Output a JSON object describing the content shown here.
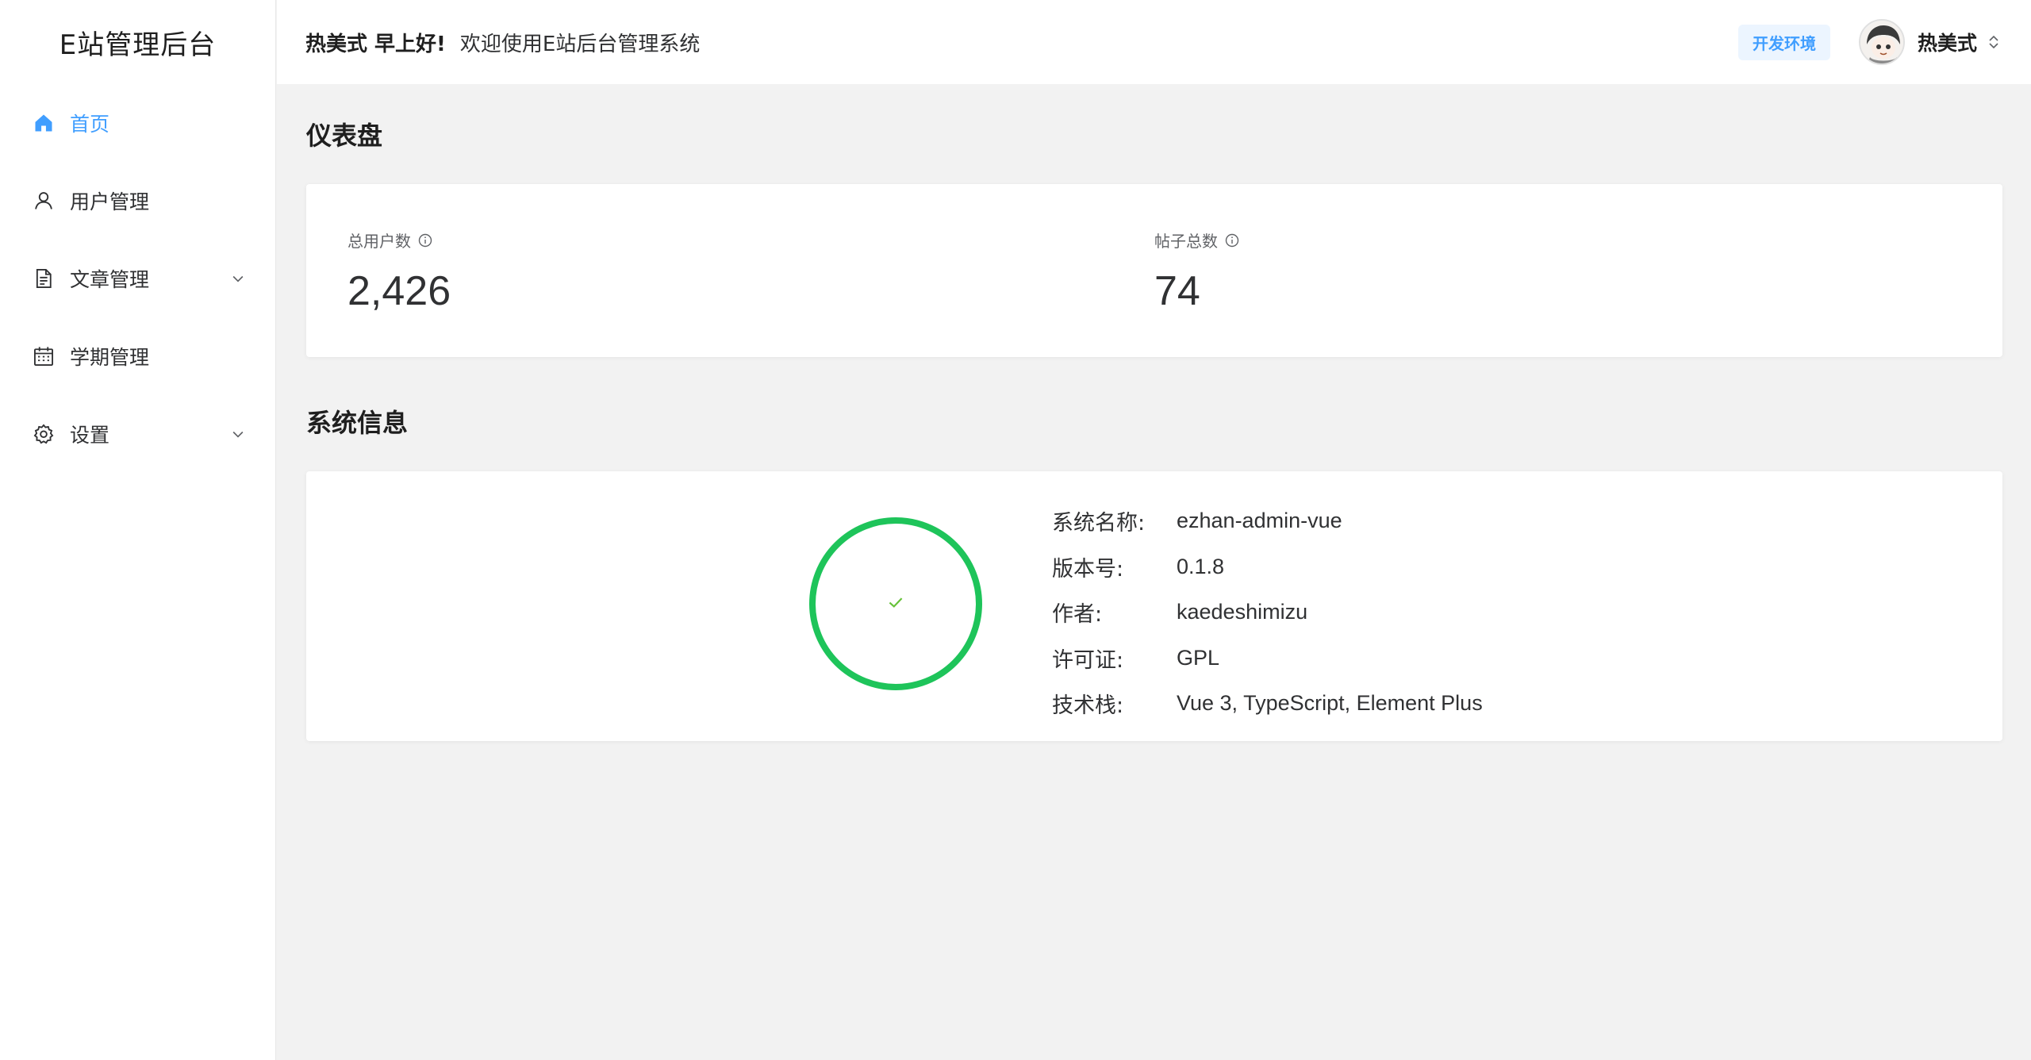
{
  "app": {
    "title": "E站管理后台"
  },
  "sidebar": {
    "items": [
      {
        "label": "首页",
        "icon": "home-icon",
        "active": true,
        "expandable": false
      },
      {
        "label": "用户管理",
        "icon": "user-icon",
        "active": false,
        "expandable": false
      },
      {
        "label": "文章管理",
        "icon": "document-icon",
        "active": false,
        "expandable": true
      },
      {
        "label": "学期管理",
        "icon": "calendar-icon",
        "active": false,
        "expandable": false
      },
      {
        "label": "设置",
        "icon": "gear-icon",
        "active": false,
        "expandable": true
      }
    ]
  },
  "header": {
    "greeting_name": "热美式 早上好!",
    "greeting_text": "欢迎使用E站后台管理系统",
    "env_tag": "开发环境",
    "user_name": "热美式"
  },
  "dashboard": {
    "title": "仪表盘",
    "stats": [
      {
        "label": "总用户数",
        "value": "2,426"
      },
      {
        "label": "帖子总数",
        "value": "74"
      }
    ]
  },
  "system_info": {
    "title": "系统信息",
    "rows": [
      {
        "key": "系统名称:",
        "value": "ezhan-admin-vue"
      },
      {
        "key": "版本号:",
        "value": "0.1.8"
      },
      {
        "key": "作者:",
        "value": "kaedeshimizu"
      },
      {
        "key": "许可证:",
        "value": "GPL"
      },
      {
        "key": "技术栈:",
        "value": "Vue 3, TypeScript, Element Plus"
      }
    ]
  },
  "colors": {
    "accent": "#409eff",
    "success_ring": "#1ec45a",
    "check_mark": "#67c23a"
  }
}
